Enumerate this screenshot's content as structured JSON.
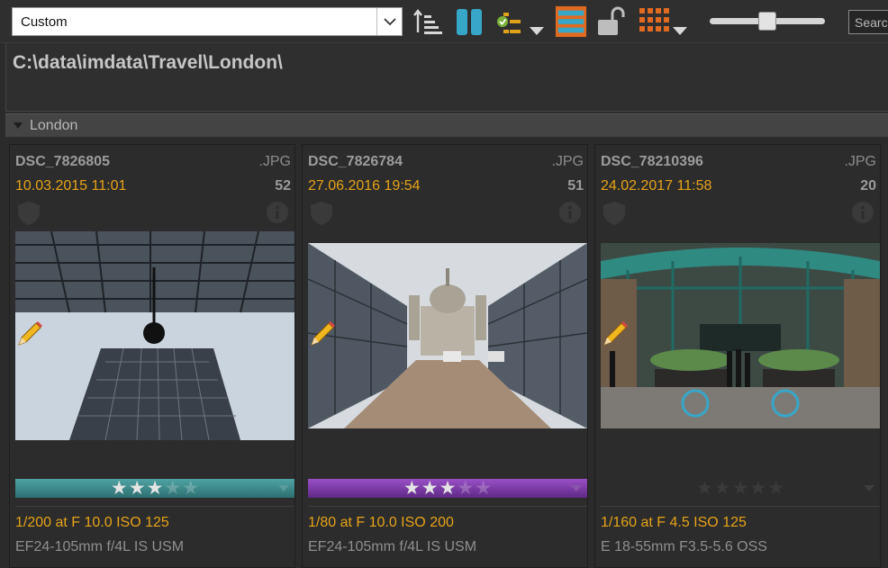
{
  "toolbar": {
    "preset": "Custom",
    "search_placeholder": "Search",
    "icons": [
      "sort-ascending-icon",
      "pause-icon",
      "filter-checklist-icon",
      "filter-dropdown-icon",
      "view-strips-icon",
      "unlock-icon",
      "grid-layout-icon",
      "grid-dropdown-icon"
    ],
    "accent_orange": "#e06a1f",
    "accent_cyan": "#36a7c9"
  },
  "path": "C:\\data\\imdata\\Travel\\London\\",
  "group": {
    "label": "London",
    "expanded": true
  },
  "images": [
    {
      "filename": "DSC_7826805",
      "extension": ".JPG",
      "date": "10.03.2015 11:01",
      "count": "52",
      "rating": 3,
      "rating_max": 5,
      "label_color": "#3d8a8a",
      "exposure": "1/200 at F 10.0 ISO 125",
      "lens": "EF24-105mm f/4L IS USM",
      "edited": true
    },
    {
      "filename": "DSC_7826784",
      "extension": ".JPG",
      "date": "27.06.2016 19:54",
      "count": "51",
      "rating": 3,
      "rating_max": 5,
      "label_color": "#7a3aa6",
      "exposure": "1/80 at F 10.0 ISO 200",
      "lens": "EF24-105mm f/4L IS USM",
      "edited": true
    },
    {
      "filename": "DSC_78210396",
      "extension": ".JPG",
      "date": "24.02.2017 11:58",
      "count": "20",
      "rating": 0,
      "rating_max": 5,
      "label_color": "",
      "exposure": "1/160 at F 4.5 ISO 125",
      "lens": "E 18-55mm F3.5-5.6 OSS",
      "edited": true
    }
  ]
}
